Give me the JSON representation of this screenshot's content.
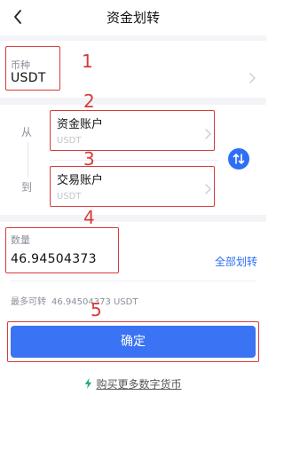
{
  "nav": {
    "title": "资金划转",
    "back_icon": "chevron-left-icon"
  },
  "coin": {
    "label": "币种",
    "value": "USDT"
  },
  "transfer": {
    "from_label": "从",
    "to_label": "到",
    "from_account": {
      "name": "资金账户",
      "currency": "USDT"
    },
    "to_account": {
      "name": "交易账户",
      "currency": "USDT"
    },
    "swap_icon": "swap-vertical-icon"
  },
  "amount": {
    "label": "数量",
    "value": "46.94504373",
    "all_button": "全部划转"
  },
  "available": {
    "label": "最多可转",
    "value": "46.94504373 USDT"
  },
  "confirm_button": "确定",
  "buy_link": "购买更多数字货币",
  "annotations": [
    "1",
    "2",
    "3",
    "4",
    "5"
  ],
  "colors": {
    "accent": "#2f6ff5",
    "annotation": "#d83a3a",
    "buy_icon": "#22b07d"
  }
}
